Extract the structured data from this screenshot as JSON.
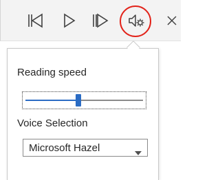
{
  "toolbar": {
    "buttons": [
      {
        "name": "previous-paragraph",
        "icon": "previous-icon"
      },
      {
        "name": "play",
        "icon": "play-icon"
      },
      {
        "name": "next-paragraph",
        "icon": "next-icon"
      },
      {
        "name": "settings",
        "icon": "voice-settings-icon"
      },
      {
        "name": "close",
        "icon": "close-icon"
      }
    ],
    "highlight_color": "#e2231a"
  },
  "settings_panel": {
    "reading_speed": {
      "label": "Reading speed",
      "value_fraction": 0.45,
      "fill_color": "#2b6cc4"
    },
    "voice_selection": {
      "label": "Voice Selection",
      "selected_value": "Microsoft Hazel"
    }
  }
}
